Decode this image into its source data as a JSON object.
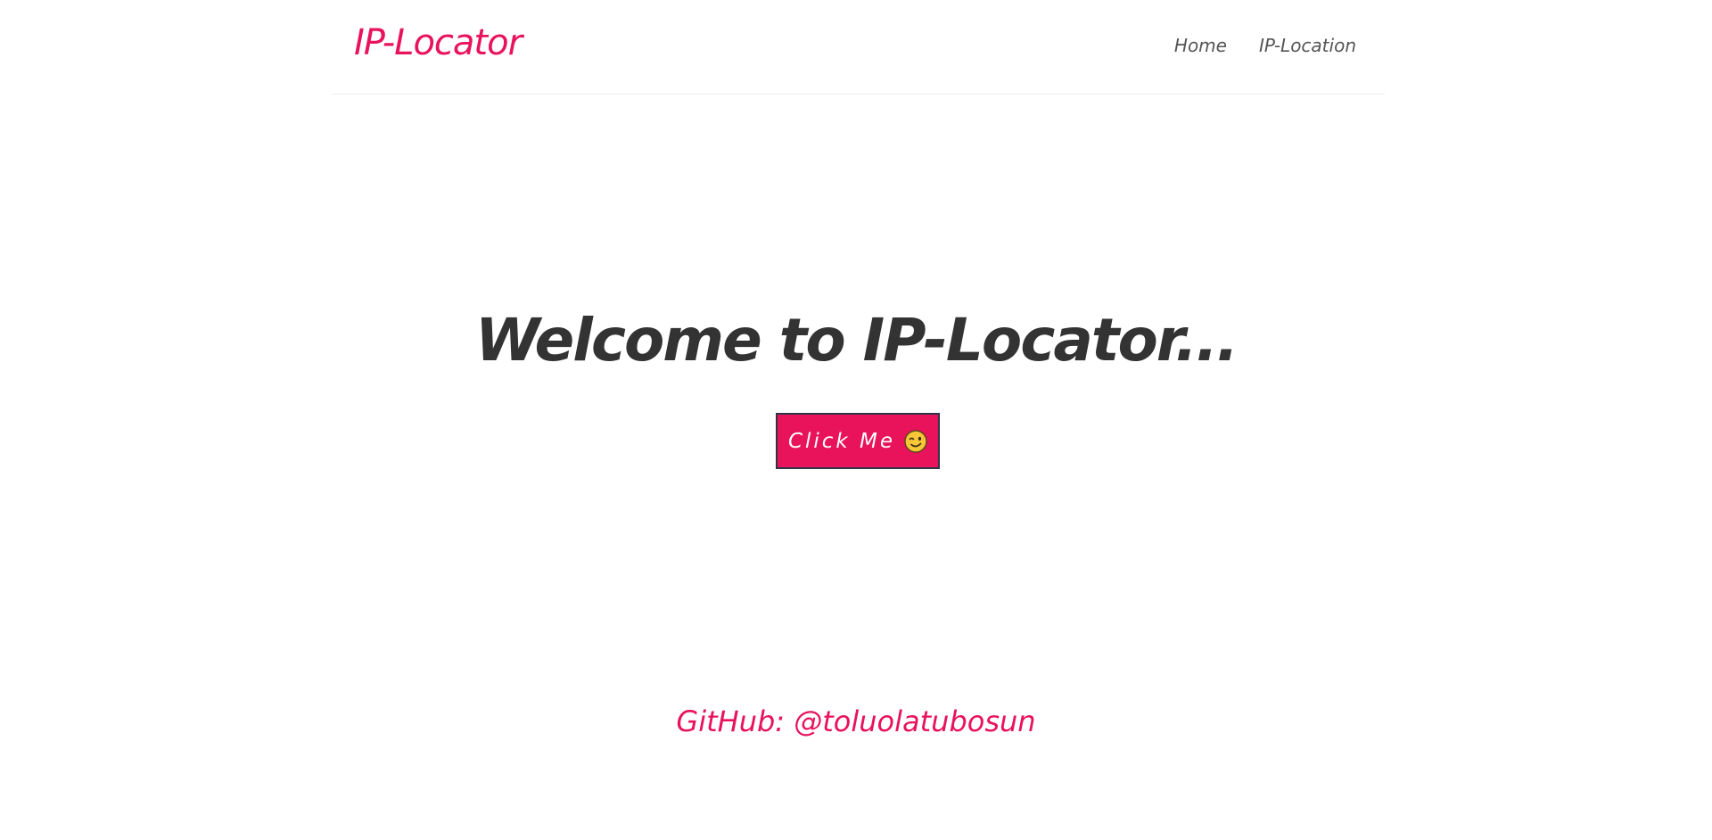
{
  "navbar": {
    "brand": "IP-Locator",
    "links": [
      {
        "label": "Home"
      },
      {
        "label": "IP-Location"
      }
    ]
  },
  "hero": {
    "title": "Welcome to IP-Locator...",
    "button_label": "Click Me",
    "button_icon": "wink-emoji-icon"
  },
  "footer": {
    "github_text": "GitHub: @toluolatubosun"
  },
  "colors": {
    "accent": "#e8135a",
    "text_dark": "#333333",
    "nav_text": "#555555",
    "button_border": "#2f3548",
    "background": "#ffffff"
  }
}
